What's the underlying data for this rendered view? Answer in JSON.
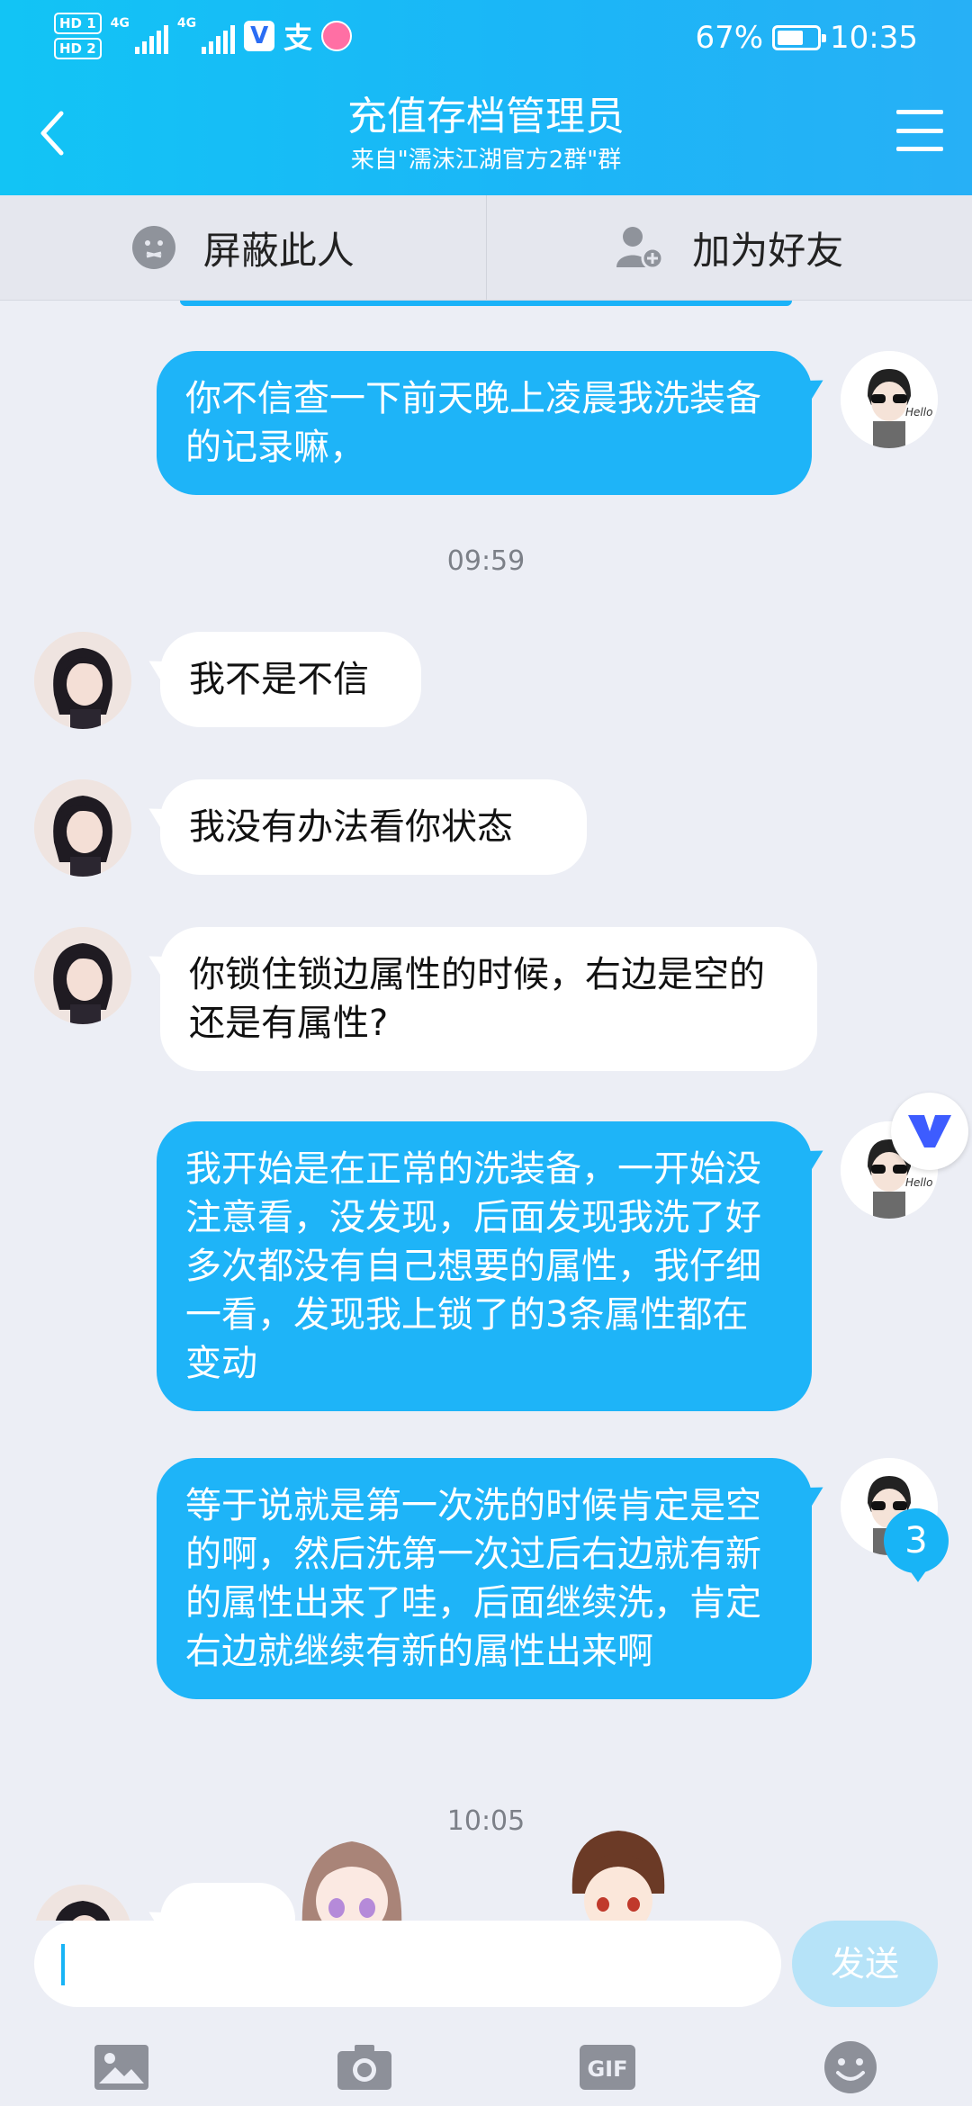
{
  "status_bar": {
    "hd1": "HD 1",
    "hd2": "HD 2",
    "net1": "4G",
    "net2": "4G",
    "vpn_badge": "V",
    "alipay": "支",
    "battery_percent": "67%",
    "battery_level": 0.67,
    "time": "10:35"
  },
  "header": {
    "title": "充值存档管理员",
    "subtitle": "来自\"濡沫江湖官方2群\"群"
  },
  "actions": {
    "block_label": "屏蔽此人",
    "add_friend_label": "加为好友"
  },
  "messages": [
    {
      "side": "out",
      "text": "你不信查一下前天晚上凌晨我洗装备的记录嘛，"
    },
    {
      "timestamp": "09:59"
    },
    {
      "side": "in",
      "text": "我不是不信"
    },
    {
      "side": "in",
      "text": "我没有办法看你状态"
    },
    {
      "side": "in",
      "text": "你锁住锁边属性的时候，右边是空的还是有属性?"
    },
    {
      "side": "out",
      "text": "我开始是在正常的洗装备，一开始没注意看，没发现，后面发现我洗了好多次都没有自己想要的属性，我仔细一看，发现我上锁了的3条属性都在变动"
    },
    {
      "side": "out",
      "text": "等于说就是第一次洗的时候肯定是空的啊，然后洗第一次过后右边就有新的属性出来了哇，后面继续洗，肯定右边就继续有新的属性出来啊"
    },
    {
      "timestamp": "10:05"
    }
  ],
  "unread_count": "3",
  "input": {
    "value": "",
    "placeholder": "",
    "send_label": "发送"
  },
  "tools": {
    "gif_label": "GIF"
  },
  "colors": {
    "accent": "#1eb4f8",
    "header_gradient_start": "#12c4f5",
    "background": "#eceef5"
  }
}
